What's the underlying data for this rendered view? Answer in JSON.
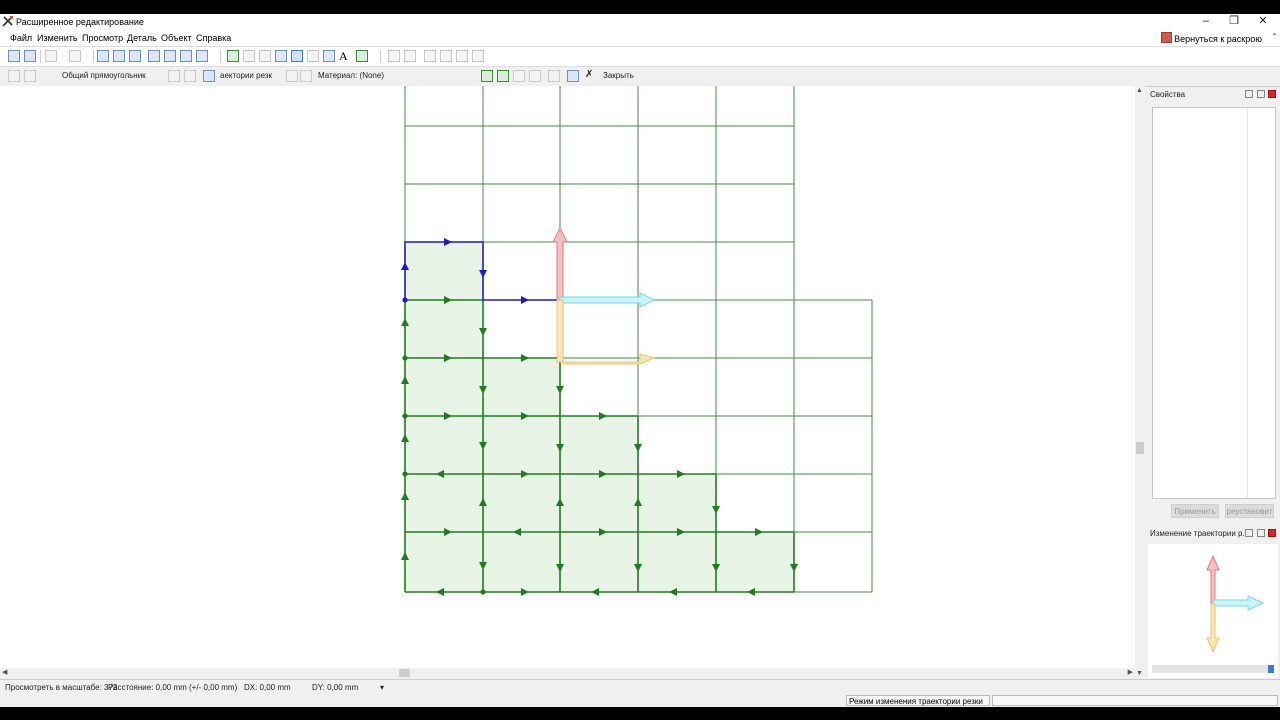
{
  "window": {
    "title": "Расширенное редактирование",
    "controls": {
      "minimize": "–",
      "restore": "❐",
      "close": "✕"
    }
  },
  "menu": {
    "items": [
      "Файл",
      "Изменить",
      "Просмотр",
      "Деталь",
      "Объект",
      "Справка"
    ],
    "back_button": "Вернуться к раскрою",
    "collapse_glyph": "⌃"
  },
  "toolbar2": {
    "general_rect": "Общий прямоугольник",
    "trajectories": "аектории резк",
    "material": "Материал: (None)",
    "close": "Закрыть"
  },
  "properties_panel": {
    "title": "Свойства",
    "apply_button": "Применить",
    "reset_button": "реустановит"
  },
  "trajectory_panel": {
    "title": "Изменение траектории р..."
  },
  "status": {
    "scale": "Просмотреть в масштабе: 372",
    "distance": "Расстояние: 0,00 mm (+/- 0,00 mm)",
    "dx": "DX: 0,00 mm",
    "dy": "DY: 0,00 mm",
    "dropdown_glyph": "▾",
    "mode": "Режим изменения траектории резки"
  },
  "colors": {
    "grid": "#3f8f3f",
    "path": "#1e7e1e",
    "selected_path": "#1a1ac8",
    "fill": "#e8f4e6",
    "axis_y": "#e89a9a",
    "axis_x": "#8ee4f0",
    "axis_l": "#f2d08a"
  }
}
